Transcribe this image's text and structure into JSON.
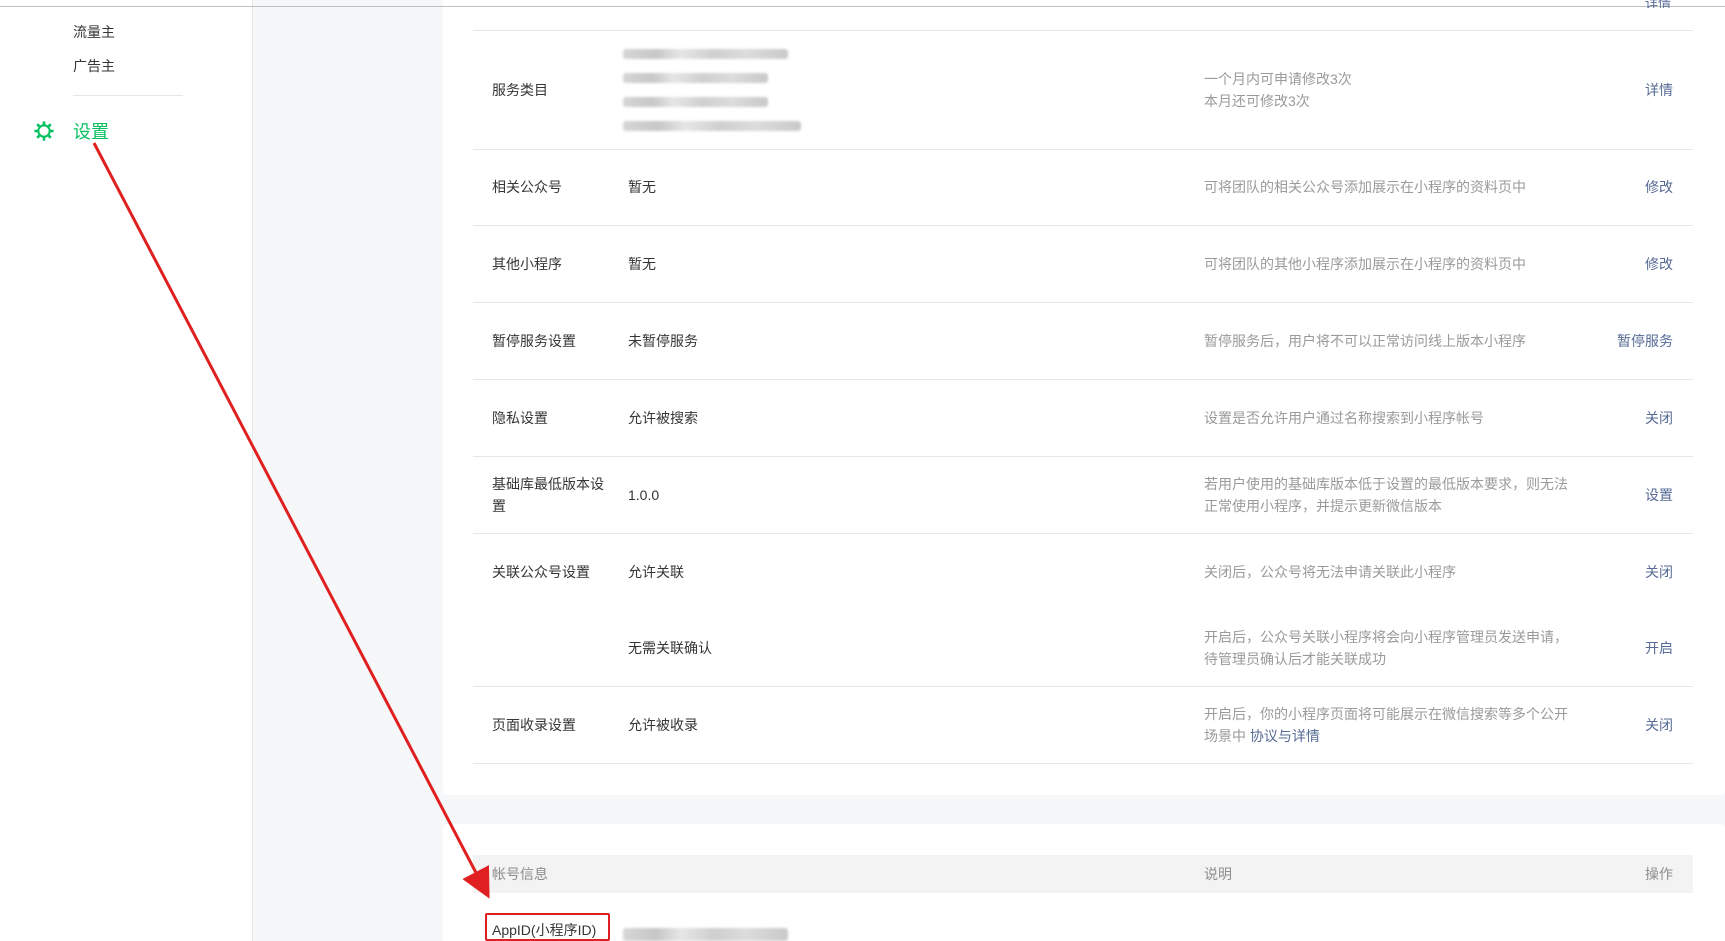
{
  "sidebar": {
    "items": [
      {
        "label": "流量主"
      },
      {
        "label": "广告主"
      }
    ],
    "settings": {
      "label": "设置",
      "icon": "gear-icon",
      "color": "#07c160"
    }
  },
  "clipped_top_action": "详情",
  "settings_rows": [
    {
      "label": "服务类目",
      "value": "",
      "desc": "一个月内可申请修改3次\n本月还可修改3次",
      "action": "详情"
    },
    {
      "label": "相关公众号",
      "value": "暂无",
      "desc": "可将团队的相关公众号添加展示在小程序的资料页中",
      "action": "修改"
    },
    {
      "label": "其他小程序",
      "value": "暂无",
      "desc": "可将团队的其他小程序添加展示在小程序的资料页中",
      "action": "修改"
    },
    {
      "label": "暂停服务设置",
      "value": "未暂停服务",
      "desc": "暂停服务后，用户将不可以正常访问线上版本小程序",
      "action": "暂停服务"
    },
    {
      "label": "隐私设置",
      "value": "允许被搜索",
      "desc": "设置是否允许用户通过名称搜索到小程序帐号",
      "action": "关闭"
    },
    {
      "label": "基础库最低版本设置",
      "value": "1.0.0",
      "desc": "若用户使用的基础库版本低于设置的最低版本要求，则无法正常使用小程序，并提示更新微信版本",
      "action": "设置"
    },
    {
      "label": "关联公众号设置",
      "value": "允许关联",
      "desc": "关闭后，公众号将无法申请关联此小程序",
      "action": "关闭"
    },
    {
      "label": "",
      "value": "无需关联确认",
      "desc": "开启后，公众号关联小程序将会向小程序管理员发送申请，待管理员确认后才能关联成功",
      "action": "开启"
    },
    {
      "label": "页面收录设置",
      "value": "允许被收录",
      "desc": "开启后，你的小程序页面将可能展示在微信搜索等多个公开场景中",
      "desc_link": "协议与详情",
      "action": "关闭"
    }
  ],
  "account_table": {
    "headers": {
      "info": "帐号信息",
      "desc": "说明",
      "action": "操作"
    },
    "appid_label": "AppID(小程序ID)"
  },
  "colors": {
    "accent": "#07c160",
    "link": "#576b95",
    "annotation": "#e02020"
  }
}
